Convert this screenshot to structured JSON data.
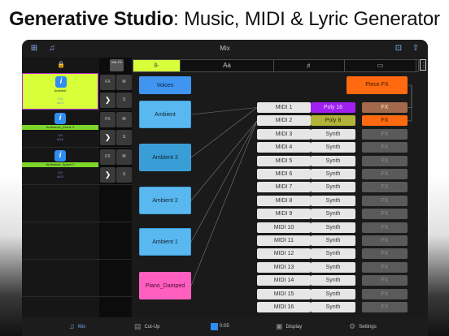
{
  "headline": {
    "brand": "Generative Studio",
    "rest": ": Music, MIDI & Lyric Generator"
  },
  "topbar": {
    "title": "Mix"
  },
  "mixfx": "Mix FX",
  "tracks": [
    {
      "bar_label": "Ambient",
      "bar_color": "#d7ff3a",
      "meta1": "C/4",
      "meta2": "#/23",
      "selected": true
    },
    {
      "bar_label": "Ambiance_Drone 3",
      "bar_color": "#7fd62a",
      "meta1": "2/4",
      "meta2": "#/16",
      "selected": false
    },
    {
      "bar_label": "Ambiance_Space 2",
      "bar_color": "#7fd62a",
      "meta1": "2/4",
      "meta2": "#/13",
      "selected": false
    }
  ],
  "ctl": {
    "fx": "FX",
    "m": "M",
    "arrow": "❯",
    "s": "S"
  },
  "tabs": [
    {
      "label": "⊪",
      "icon": "routing-icon"
    },
    {
      "label": "Aa",
      "icon": "lyrics-icon"
    },
    {
      "label": "♬",
      "icon": "score-icon"
    },
    {
      "label": "▭",
      "icon": "comment-icon"
    }
  ],
  "more": "⋮",
  "sources": [
    "Voices",
    "Ambient",
    "Ambient 3",
    "Ambient 2",
    "Ambient 1",
    "Piano_Damped"
  ],
  "piece_fx": "Piece FX",
  "midi": [
    "MIDI 1",
    "MIDI 2",
    "MIDI 3",
    "MIDI 4",
    "MIDI 5",
    "MIDI 6",
    "MIDI 7",
    "MIDI 8",
    "MIDI 9",
    "MIDI 10",
    "MIDI 11",
    "MIDI 12",
    "MIDI 13",
    "MIDI 14",
    "MIDI 15",
    "MIDI 16"
  ],
  "synth": [
    "Poly 16",
    "Poly 8",
    "Synth",
    "Synth",
    "Synth",
    "Synth",
    "Synth",
    "Synth",
    "Synth",
    "Synth",
    "Synth",
    "Synth",
    "Synth",
    "Synth",
    "Synth",
    "Synth"
  ],
  "fx_label": "FX",
  "bottom": {
    "mix": "Mix",
    "cutup": "Cut-Up",
    "time": "0:05",
    "display": "Display",
    "settings": "Settings"
  },
  "colors": {
    "accent": "#d7ff3a",
    "blue": "#2f8cf0",
    "orange": "#ff6a10",
    "purple": "#a020f0",
    "olive": "#b2b43a",
    "fx_active_1": "#a4694c",
    "fx_active_2": "#ff6a10"
  }
}
